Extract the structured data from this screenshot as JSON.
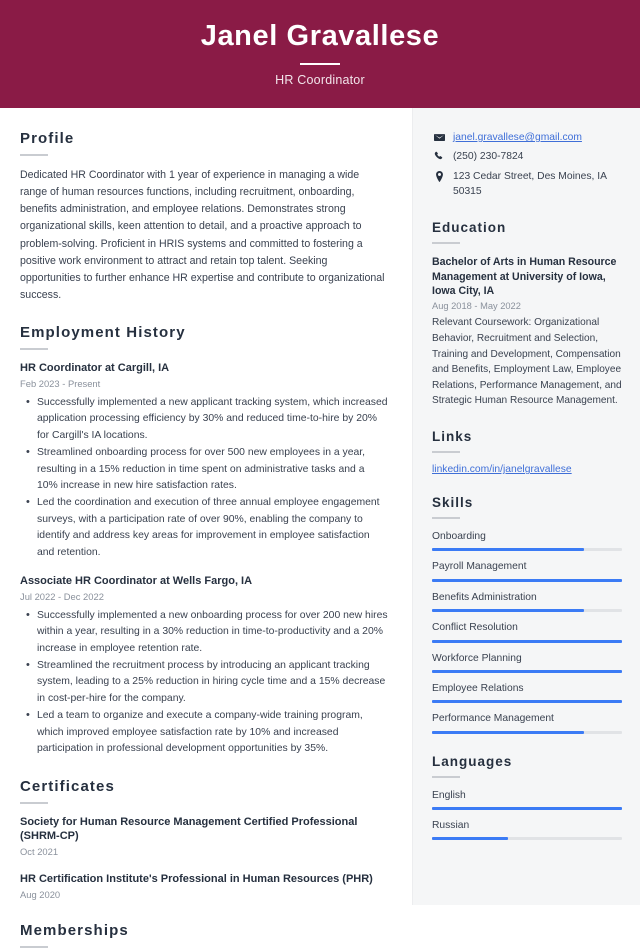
{
  "header": {
    "name": "Janel Gravallese",
    "job_title": "HR Coordinator",
    "bg_color": "#8a1b46"
  },
  "main": {
    "profile": {
      "heading": "Profile",
      "text": "Dedicated HR Coordinator with 1 year of experience in managing a wide range of human resources functions, including recruitment, onboarding, benefits administration, and employee relations. Demonstrates strong organizational skills, keen attention to detail, and a proactive approach to problem-solving. Proficient in HRIS systems and committed to fostering a positive work environment to attract and retain top talent. Seeking opportunities to further enhance HR expertise and contribute to organizational success."
    },
    "employment": {
      "heading": "Employment History",
      "entries": [
        {
          "title": "HR Coordinator at Cargill, IA",
          "date": "Feb 2023 - Present",
          "bullets": [
            "Successfully implemented a new applicant tracking system, which increased application processing efficiency by 30% and reduced time-to-hire by 20% for Cargill's IA locations.",
            "Streamlined onboarding process for over 500 new employees in a year, resulting in a 15% reduction in time spent on administrative tasks and a 10% increase in new hire satisfaction rates.",
            "Led the coordination and execution of three annual employee engagement surveys, with a participation rate of over 90%, enabling the company to identify and address key areas for improvement in employee satisfaction and retention."
          ]
        },
        {
          "title": "Associate HR Coordinator at Wells Fargo, IA",
          "date": "Jul 2022 - Dec 2022",
          "bullets": [
            "Successfully implemented a new onboarding process for over 200 new hires within a year, resulting in a 30% reduction in time-to-productivity and a 20% increase in employee retention rate.",
            "Streamlined the recruitment process by introducing an applicant tracking system, leading to a 25% reduction in hiring cycle time and a 15% decrease in cost-per-hire for the company.",
            "Led a team to organize and execute a company-wide training program, which improved employee satisfaction rate by 10% and increased participation in professional development opportunities by 35%."
          ]
        }
      ]
    },
    "certificates": {
      "heading": "Certificates",
      "entries": [
        {
          "title": "Society for Human Resource Management Certified Professional (SHRM-CP)",
          "date": "Oct 2021"
        },
        {
          "title": "HR Certification Institute's Professional in Human Resources (PHR)",
          "date": "Aug 2020"
        }
      ]
    },
    "memberships": {
      "heading": "Memberships"
    }
  },
  "sidebar": {
    "contact": [
      {
        "icon": "envelope-icon",
        "text": "janel.gravallese@gmail.com",
        "is_link": true
      },
      {
        "icon": "phone-icon",
        "text": "(250) 230-7824",
        "is_link": false
      },
      {
        "icon": "location-pin-icon",
        "text": "123 Cedar Street, Des Moines, IA 50315",
        "is_link": false
      }
    ],
    "education": {
      "heading": "Education",
      "title": "Bachelor of Arts in Human Resource Management at University of Iowa, Iowa City, IA",
      "date": "Aug 2018 - May 2022",
      "description": "Relevant Coursework: Organizational Behavior, Recruitment and Selection, Training and Development, Compensation and Benefits, Employment Law, Employee Relations, Performance Management, and Strategic Human Resource Management."
    },
    "links": {
      "heading": "Links",
      "items": [
        {
          "label": "linkedin.com/in/janelgravallese"
        }
      ]
    },
    "skills": {
      "heading": "Skills",
      "items": [
        {
          "label": "Onboarding",
          "level": 80
        },
        {
          "label": "Payroll Management",
          "level": 100
        },
        {
          "label": "Benefits Administration",
          "level": 80
        },
        {
          "label": "Conflict Resolution",
          "level": 100
        },
        {
          "label": "Workforce Planning",
          "level": 100
        },
        {
          "label": "Employee Relations",
          "level": 100
        },
        {
          "label": "Performance Management",
          "level": 80
        }
      ]
    },
    "languages": {
      "heading": "Languages",
      "items": [
        {
          "label": "English",
          "level": 100
        },
        {
          "label": "Russian",
          "level": 40
        }
      ]
    },
    "accent_color": "#3b7bf5",
    "track_color": "#e1e3e6",
    "link_color": "#3f6fd8"
  }
}
